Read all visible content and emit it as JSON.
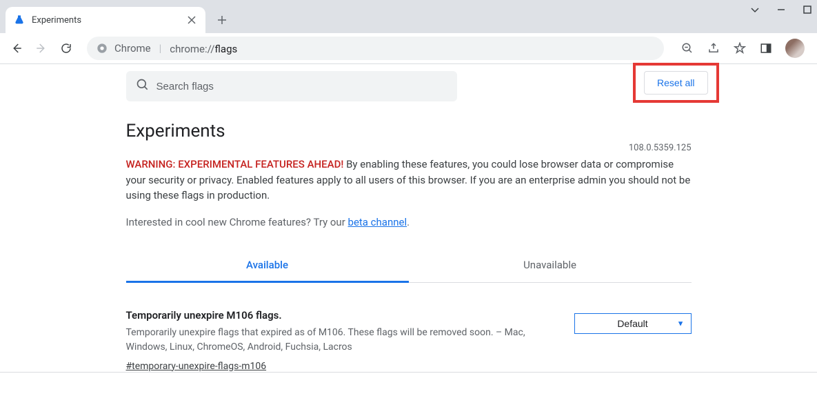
{
  "window": {
    "tab_title": "Experiments"
  },
  "toolbar": {
    "site_name": "Chrome",
    "url_protocol": "chrome://",
    "url_path": "flags"
  },
  "search": {
    "placeholder": "Search flags"
  },
  "actions": {
    "reset_label": "Reset all"
  },
  "page": {
    "title": "Experiments",
    "version": "108.0.5359.125",
    "warning_prefix": "WARNING: EXPERIMENTAL FEATURES AHEAD!",
    "warning_body": " By enabling these features, you could lose browser data or compromise your security or privacy. Enabled features apply to all users of this browser. If you are an enterprise admin you should not be using these flags in production.",
    "beta_prefix": "Interested in cool new Chrome features? Try our ",
    "beta_link": "beta channel",
    "beta_suffix": "."
  },
  "tabs": {
    "available": "Available",
    "unavailable": "Unavailable"
  },
  "flags": [
    {
      "title": "Temporarily unexpire M106 flags.",
      "desc": "Temporarily unexpire flags that expired as of M106. These flags will be removed soon. – Mac, Windows, Linux, ChromeOS, Android, Fuchsia, Lacros",
      "anchor": "#temporary-unexpire-flags-m106",
      "selected": "Default"
    }
  ]
}
